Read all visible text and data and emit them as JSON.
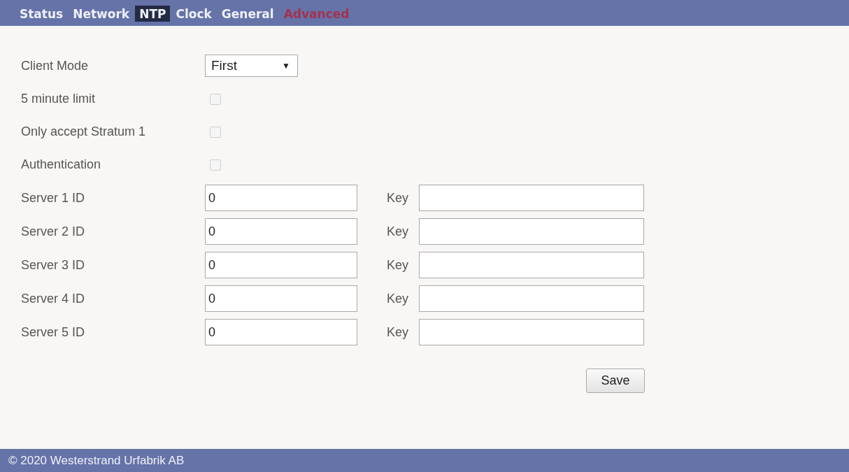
{
  "tabs": [
    {
      "label": "Status",
      "selected": false,
      "disabled": false
    },
    {
      "label": "Network",
      "selected": false,
      "disabled": false
    },
    {
      "label": "NTP",
      "selected": true,
      "disabled": false
    },
    {
      "label": "Clock",
      "selected": false,
      "disabled": false
    },
    {
      "label": "General",
      "selected": false,
      "disabled": false
    },
    {
      "label": "Advanced",
      "selected": false,
      "disabled": true
    }
  ],
  "client_mode": {
    "label": "Client Mode",
    "value": "First",
    "caret": "▼"
  },
  "options": [
    {
      "label": "5 minute limit",
      "checked": false,
      "disabled": true
    },
    {
      "label": "Only accept Stratum 1",
      "checked": false,
      "disabled": true
    },
    {
      "label": "Authentication",
      "checked": false,
      "disabled": true
    }
  ],
  "servers": [
    {
      "label": "Server 1 ID",
      "value": "0",
      "key_label": "Key"
    },
    {
      "label": "Server 2 ID",
      "value": "0",
      "key_label": "Key"
    },
    {
      "label": "Server 3 ID",
      "value": "0",
      "key_label": "Key"
    },
    {
      "label": "Server 4 ID",
      "value": "0",
      "key_label": "Key"
    },
    {
      "label": "Server 5 ID",
      "value": "0",
      "key_label": "Key"
    }
  ],
  "save_button": "Save",
  "footer": "© 2020 Westerstrand Urfabrik AB"
}
